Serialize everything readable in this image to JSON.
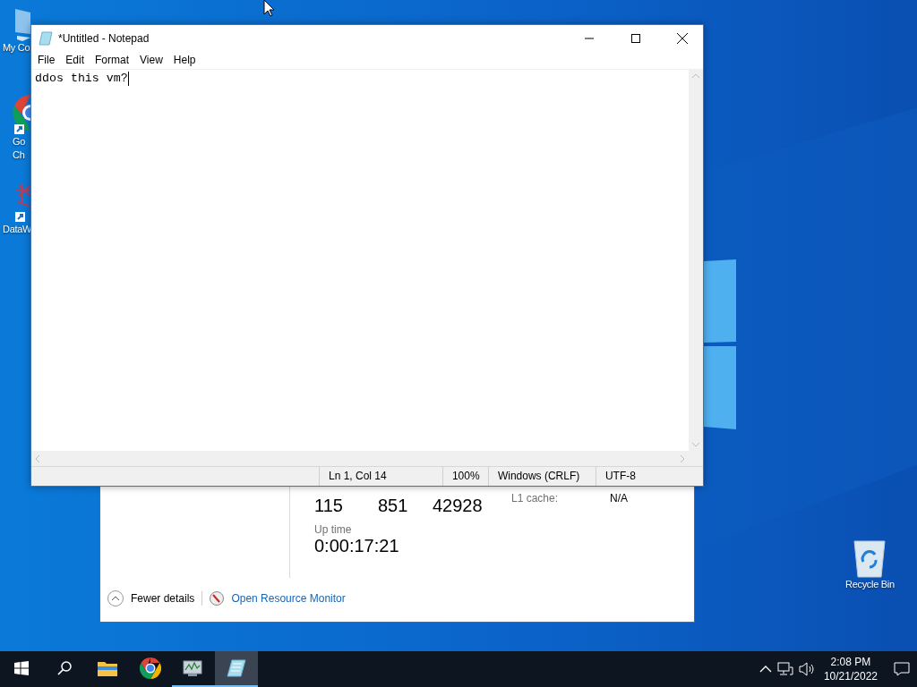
{
  "desktop_icons": [
    {
      "kind": "computer",
      "lines": [
        "My Co"
      ]
    },
    {
      "kind": "chrome",
      "lines": [
        "Go",
        "Ch"
      ]
    },
    {
      "kind": "app",
      "lines": [
        "DataW"
      ]
    },
    {
      "kind": "recycle",
      "lines": [
        "Recycle Bin"
      ]
    }
  ],
  "task_manager": {
    "stats": [
      "115",
      "851",
      "42928"
    ],
    "info": [
      {
        "label": "L1 cache:",
        "value": "N/A"
      }
    ],
    "uptime_label": "Up time",
    "uptime": "0:00:17:21",
    "fewer_details": "Fewer details",
    "resource_monitor": "Open Resource Monitor"
  },
  "notepad": {
    "title": "*Untitled - Notepad",
    "menu": [
      "File",
      "Edit",
      "Format",
      "View",
      "Help"
    ],
    "text": "ddos this vm?",
    "status": [
      "Ln 1, Col 14",
      "100%",
      "Windows (CRLF)",
      "UTF-8"
    ]
  },
  "taskbar": {
    "apps": [
      {
        "kind": "start",
        "running": false,
        "active": false
      },
      {
        "kind": "search",
        "running": false,
        "active": false
      },
      {
        "kind": "explorer",
        "running": false,
        "active": false
      },
      {
        "kind": "chrome",
        "running": false,
        "active": false
      },
      {
        "kind": "taskmgr",
        "running": true,
        "active": false
      },
      {
        "kind": "notepad",
        "running": true,
        "active": true
      }
    ],
    "time": "2:08 PM",
    "date": "10/21/2022"
  }
}
